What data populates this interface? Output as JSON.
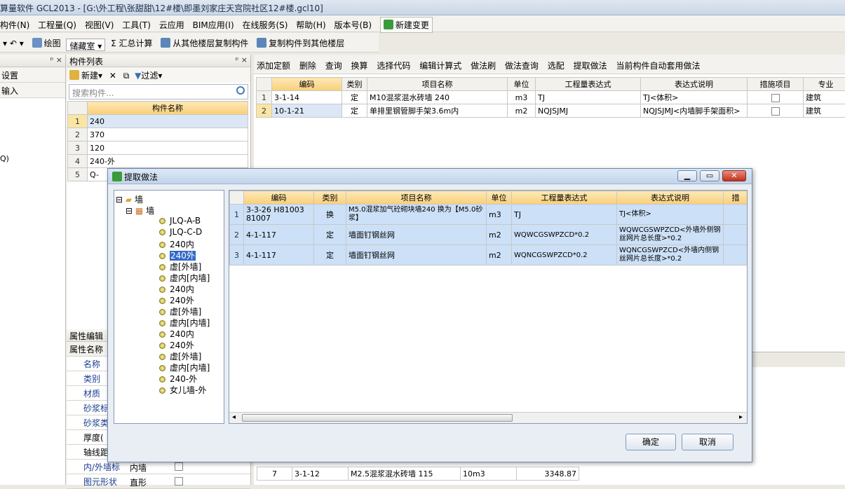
{
  "window": {
    "title": "算量软件 GCL2013 - [G:\\外工程\\张甜甜\\12#楼\\即墨刘家庄天宫院社区12#楼.gcl10]"
  },
  "menu": {
    "items": [
      "构件(N)",
      "工程量(Q)",
      "视图(V)",
      "工具(T)",
      "云应用",
      "BIM应用(I)",
      "在线服务(S)",
      "帮助(H)",
      "版本号(B)"
    ],
    "new_change": "新建变更"
  },
  "toolbar1": {
    "draw": "绘图",
    "combo": "储藏室",
    "sum": "汇总计算",
    "copy_from": "从其他楼层复制构件",
    "copy_to": "复制构件到其他楼层"
  },
  "left_panel": {
    "row1": "设置",
    "row2": "输入",
    "code_fragment": "Q)"
  },
  "component_list": {
    "title": "构件列表",
    "new_label": "新建",
    "filter_label": "过滤",
    "search_placeholder": "搜索构件...",
    "column": "构件名称",
    "rows": [
      {
        "num": "1",
        "name": "240"
      },
      {
        "num": "2",
        "name": "370"
      },
      {
        "num": "3",
        "name": "120"
      },
      {
        "num": "4",
        "name": "240-外"
      },
      {
        "num": "5",
        "name": "Q-"
      }
    ]
  },
  "right_toolbar": [
    "添加定额",
    "删除",
    "查询",
    "换算",
    "选择代码",
    "编辑计算式",
    "做法刷",
    "做法查询",
    "选配",
    "提取做法",
    "当前构件自动套用做法"
  ],
  "main_grid": {
    "headers": [
      "编码",
      "类别",
      "项目名称",
      "单位",
      "工程量表达式",
      "表达式说明",
      "措施项目",
      "专业"
    ],
    "rows": [
      {
        "num": "1",
        "code": "3-1-14",
        "type": "定",
        "name": "M10混浆混水砖墙 240",
        "unit": "m3",
        "expr": "TJ",
        "desc": "TJ<体积>",
        "major": "建筑"
      },
      {
        "num": "2",
        "code": "10-1-21",
        "type": "定",
        "name": "单排里钢管脚手架3.6m内",
        "unit": "m2",
        "expr": "NQJSJMJ",
        "desc": "NQJSJMJ<内墙脚手架面积>",
        "major": "建筑"
      }
    ]
  },
  "properties": {
    "title": "属性编辑",
    "header": "属性名称",
    "rows": [
      "名称",
      "类别",
      "材质",
      "砂浆标",
      "砂浆类",
      "厚度(",
      "轴线距",
      "内/外墙标",
      "图元形状"
    ],
    "values": {
      "inout": "内墙",
      "shape": "直形"
    }
  },
  "bottom_grid": {
    "rows": [
      {
        "num": "7",
        "code": "3-1-12",
        "name": "M2.5混浆混水砖墙 115",
        "unit": "10m3",
        "value": "3348.87"
      }
    ]
  },
  "dialog": {
    "title": "提取做法",
    "tree": {
      "root": "墙",
      "child": "墙",
      "leaves": [
        "JLQ-A-B",
        "JLQ-C-D",
        "240内",
        "240外",
        "虚[外墙]",
        "虚内[内墙]",
        "240内",
        "240外",
        "虚[外墙]",
        "虚内[内墙]",
        "240内",
        "240外",
        "虚[外墙]",
        "虚内[内墙]",
        "240-外",
        "女儿墙-外"
      ],
      "selected_index": 3
    },
    "grid": {
      "headers": [
        "编码",
        "类别",
        "项目名称",
        "单位",
        "工程量表达式",
        "表达式说明",
        "措"
      ],
      "rows": [
        {
          "num": "1",
          "code": "3-3-26 H81003 81007",
          "type": "换",
          "name": "M5.0混浆加气砼砌块墙240 换为【M5.0砂浆】",
          "unit": "m3",
          "expr": "TJ",
          "desc": "TJ<体积>"
        },
        {
          "num": "2",
          "code": "4-1-117",
          "type": "定",
          "name": "墙面钉钢丝网",
          "unit": "m2",
          "expr": "WQWCGSWPZCD*0.2",
          "desc": "WQWCGSWPZCD<外墙外侧钢丝网片总长度>*0.2"
        },
        {
          "num": "3",
          "code": "4-1-117",
          "type": "定",
          "name": "墙面钉钢丝网",
          "unit": "m2",
          "expr": "WQNCGSWPZCD*0.2",
          "desc": "WQNCGSWPZCD<外墙内侧钢丝网片总长度>*0.2"
        }
      ]
    },
    "ok": "确定",
    "cancel": "取消"
  }
}
